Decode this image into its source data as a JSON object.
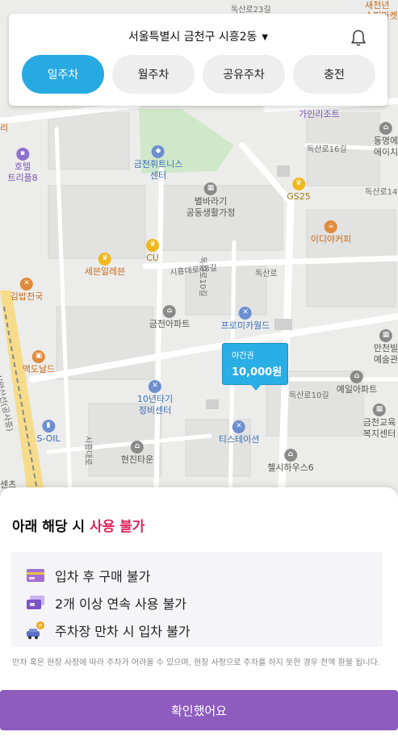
{
  "header": {
    "location": "서울특별시 금천구 시흥2동",
    "tabs": [
      {
        "label": "일주차",
        "active": true
      },
      {
        "label": "월주차",
        "active": false
      },
      {
        "label": "공유주차",
        "active": false
      },
      {
        "label": "충전",
        "active": false
      }
    ]
  },
  "map": {
    "roads": [
      "독산로23길",
      "독산로16길",
      "독산로14",
      "시흥대로48길",
      "독산로",
      "독산로10길",
      "시흥대로",
      "독산로10길",
      "신안산선(공사중)"
    ],
    "pois": [
      {
        "name": "금천휘트니스\n센터",
        "icon": "gym-icon"
      },
      {
        "name": "가인리조트",
        "icon": ""
      },
      {
        "name": "GS25",
        "icon": "convenience-store-icon"
      },
      {
        "name": "별바라기\n공동생활가정",
        "icon": "building-icon"
      },
      {
        "name": "호텔\n트리플8",
        "icon": "hotel-icon"
      },
      {
        "name": "세븐일레븐",
        "icon": "convenience-store-icon"
      },
      {
        "name": "CU",
        "icon": "convenience-store-icon"
      },
      {
        "name": "이디야커피",
        "icon": "cafe-icon"
      },
      {
        "name": "김밥천국",
        "icon": "restaurant-icon"
      },
      {
        "name": "금천아파트",
        "icon": "apartment-icon"
      },
      {
        "name": "프로미카월드",
        "icon": "car-service-icon"
      },
      {
        "name": "맥도날드",
        "icon": "restaurant-icon"
      },
      {
        "name": "10년타기\n정비센터",
        "icon": "car-service-icon"
      },
      {
        "name": "S-OIL",
        "icon": "gas-station-icon"
      },
      {
        "name": "현진타운",
        "icon": "apartment-icon"
      },
      {
        "name": "티스테이션",
        "icon": "car-service-icon"
      },
      {
        "name": "첼시하우스6",
        "icon": "apartment-icon"
      },
      {
        "name": "예일아파트",
        "icon": "apartment-icon"
      },
      {
        "name": "금천교육\n복지센터",
        "icon": "building-icon"
      },
      {
        "name": "만천빌\n예술관",
        "icon": "building-icon"
      },
      {
        "name": "동명에\n에이치",
        "icon": "apartment-icon"
      },
      {
        "name": "새천년\n수퍼마켓",
        "icon": ""
      },
      {
        "name": "센츠",
        "icon": ""
      },
      {
        "name": "리",
        "icon": ""
      }
    ],
    "price_marker": {
      "tier": "야간권",
      "price": "10,000원"
    }
  },
  "sheet": {
    "title_prefix": "아래 해당 시 ",
    "title_highlight": "사용 불가",
    "items": [
      {
        "icon": "credit-card-icon",
        "text": "입차 후 구매 불가"
      },
      {
        "icon": "tickets-icon",
        "text": "2개 이상 연속 사용 불가"
      },
      {
        "icon": "parking-car-icon",
        "text": "주차장 만차 시 입차 불가"
      }
    ],
    "fine_print": "만차 혹은 현장 사정에 따라 주차가 어려울 수 있으며, 현장 사정으로 주차를 하지 못한 경우 전액 환불 됩니다.",
    "confirm_label": "확인했어요"
  },
  "colors": {
    "active_tab": "#27aae2",
    "highlight": "#e3245a",
    "confirm": "#8e5cbf",
    "price_marker": "#29aee6"
  }
}
